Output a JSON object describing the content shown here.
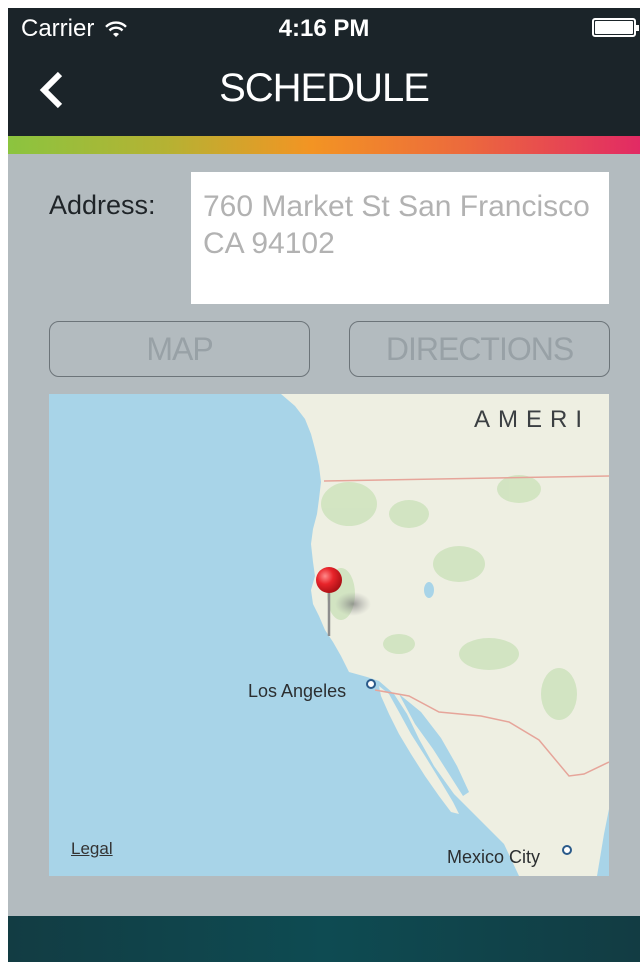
{
  "status": {
    "carrier": "Carrier",
    "time": "4:16 PM"
  },
  "nav": {
    "title": "SCHEDULE"
  },
  "address": {
    "label": "Address:",
    "placeholder": "760 Market St San Francisco CA 94102"
  },
  "buttons": {
    "map": "MAP",
    "directions": "DIRECTIONS"
  },
  "map": {
    "region_label": "AMERI",
    "cities": [
      "Los Angeles",
      "Mexico City"
    ],
    "legal": "Legal",
    "pin_color": "#e8242a",
    "ocean_color": "#a8d4e8",
    "land_color": "#eeefe2"
  },
  "colors": {
    "nav_bg": "#1b2429",
    "screen_bg": "#b3bbbf",
    "accent_gradient": [
      "#8bc43f",
      "#f39423",
      "#e22a64"
    ],
    "bottom_bar": "#123c43"
  }
}
